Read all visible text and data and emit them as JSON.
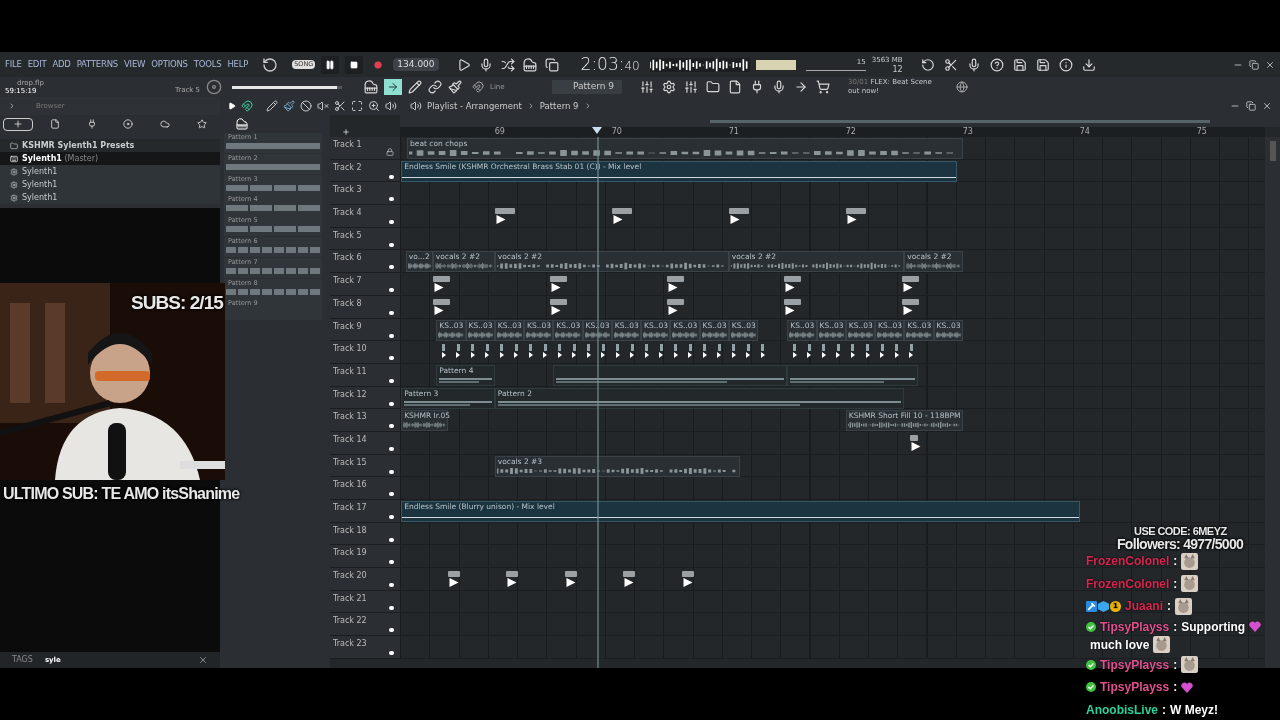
{
  "menu": [
    "FILE",
    "EDIT",
    "ADD",
    "PATTERNS",
    "VIEW",
    "OPTIONS",
    "TOOLS",
    "HELP"
  ],
  "transport": {
    "mode": "SONG",
    "song_selected": true,
    "tempo": "134.000",
    "time_main": "2:03:",
    "time_sub": "40"
  },
  "stats": {
    "cpu": "15",
    "memory": "3563 MB",
    "polyphony": "12"
  },
  "project": {
    "file": "drop.flp",
    "time": "59:15:19",
    "hint": "Track 5"
  },
  "snap": "Line",
  "pattern": "Pattern 9",
  "news_date": "30/01",
  "news_text": "FLEX: Beat Scene out now!",
  "browser": {
    "title": "Browser",
    "tabs": [
      {
        "kind": "all",
        "selected": true
      },
      {
        "kind": "file",
        "selected": false
      },
      {
        "kind": "plugin",
        "selected": false
      },
      {
        "kind": "disc",
        "selected": false
      },
      {
        "kind": "cloud",
        "selected": false
      },
      {
        "kind": "star",
        "selected": false
      }
    ],
    "items": [
      {
        "kind": "folder",
        "label": "KSHMR Sylenth1 Presets",
        "selected": false
      },
      {
        "kind": "synth",
        "label": "Sylenth1",
        "note": "(Master)",
        "selected": true
      },
      {
        "kind": "gear",
        "label": "Sylenth1",
        "selected": false
      },
      {
        "kind": "gear",
        "label": "Sylenth1",
        "selected": false
      },
      {
        "kind": "gear",
        "label": "Sylenth1",
        "selected": false
      }
    ],
    "tags_label": "TAGS",
    "tags_value": "syle"
  },
  "picker": [
    "Pattern 1",
    "Pattern 2",
    "Pattern 3",
    "Pattern 4",
    "Pattern 5",
    "Pattern 6",
    "Pattern 7",
    "Pattern 8",
    "Pattern 9"
  ],
  "volume": {
    "level": 0.95
  },
  "playlist": {
    "title": "Playlist - Arrangement",
    "pattern": "Pattern 9",
    "ruler": [
      "69",
      "70",
      "71",
      "72",
      "73",
      "74",
      "75"
    ],
    "tracks": [
      {
        "name": "Track 1",
        "locked": true,
        "clips": [
          "beat con chops"
        ]
      },
      {
        "name": "Track 2",
        "locked": false,
        "clips": [
          "Endless Smile (KSHMR Orchestral Brass Stab 01 (C)) - Mix level"
        ]
      },
      {
        "name": "Track 3",
        "locked": false
      },
      {
        "name": "Track 4",
        "locked": false
      },
      {
        "name": "Track 5",
        "locked": false
      },
      {
        "name": "Track 6",
        "locked": false,
        "clips": [
          "vo...2",
          "vocals 2 #2",
          "vocals 2 #2",
          "vocals 2 #2",
          "vocals 2 #2"
        ]
      },
      {
        "name": "Track 7",
        "locked": false
      },
      {
        "name": "Track 8",
        "locked": false
      },
      {
        "name": "Track 9",
        "locked": false,
        "clips": [
          "KS..03",
          "KS..03",
          "KS..03",
          "KS..03",
          "KS..03",
          "KS..03",
          "KS..03",
          "KS..03",
          "KS..03",
          "KS..03",
          "KS..03",
          "KS..03",
          "KS..03",
          "KS..03",
          "KS..03",
          "KS..03",
          "KS..03"
        ]
      },
      {
        "name": "Track 10",
        "locked": false
      },
      {
        "name": "Track 11",
        "locked": false,
        "clips": [
          "Pattern 4"
        ]
      },
      {
        "name": "Track 12",
        "locked": false,
        "clips": [
          "Pattern 3",
          "Pattern 2"
        ]
      },
      {
        "name": "Track 13",
        "locked": false,
        "clips": [
          "KSHMR Ir.05",
          "KSHMR Short Fill 10 - 118BPM"
        ]
      },
      {
        "name": "Track 14",
        "locked": false
      },
      {
        "name": "Track 15",
        "locked": false,
        "clips": [
          "vocals 2 #3"
        ]
      },
      {
        "name": "Track 16",
        "locked": false
      },
      {
        "name": "Track 17",
        "locked": false,
        "clips": [
          "Endless Smile (Blurry unison) - Mix level"
        ]
      },
      {
        "name": "Track 18",
        "locked": false
      },
      {
        "name": "Track 19",
        "locked": false
      },
      {
        "name": "Track 20",
        "locked": false
      },
      {
        "name": "Track 21",
        "locked": false
      },
      {
        "name": "Track 22",
        "locked": false
      },
      {
        "name": "Track 23",
        "locked": false
      }
    ]
  },
  "overlay": {
    "subs": "SUBS: 2/15",
    "last_sub": "ULTIMO SUB: TE AMO itsShanime",
    "code": "USE CODE: 6MEYZ",
    "followers": "Followers: 4977/5000"
  },
  "chat": [
    {
      "user": "FrozenColonel",
      "color": "#d8264f",
      "sep": ":",
      "parts": [
        {
          "kind": "emote"
        }
      ]
    },
    {
      "user": "FrozenColonel",
      "color": "#d8264f",
      "sep": ":",
      "parts": [
        {
          "kind": "emote"
        }
      ]
    },
    {
      "user": "Juaani",
      "color": "#d8264f",
      "sep": ":",
      "badges": [
        {
          "kind": "hammer"
        },
        {
          "kind": "cube"
        },
        {
          "kind": "count",
          "text": "1"
        }
      ],
      "parts": [
        {
          "kind": "emote"
        }
      ]
    },
    {
      "user": "TipsyPlayss",
      "color": "#e0508f",
      "sep": ":",
      "badges": [
        {
          "kind": "check"
        }
      ],
      "parts": [
        {
          "kind": "text",
          "text": "Supporting"
        },
        {
          "kind": "heart"
        },
        {
          "kind": "text",
          "text": "much love"
        },
        {
          "kind": "emote"
        }
      ]
    },
    {
      "user": "TipsyPlayss",
      "color": "#e0508f",
      "sep": ":",
      "badges": [
        {
          "kind": "check"
        }
      ],
      "parts": [
        {
          "kind": "emote"
        }
      ]
    },
    {
      "user": "TipsyPlayss",
      "color": "#e0508f",
      "sep": ":",
      "badges": [
        {
          "kind": "check"
        }
      ],
      "parts": [
        {
          "kind": "heart"
        }
      ]
    },
    {
      "user": "AnoobisLive",
      "color": "#2fcf9a",
      "sep": ":",
      "parts": [
        {
          "kind": "text",
          "text": "W Meyz!"
        }
      ]
    }
  ]
}
